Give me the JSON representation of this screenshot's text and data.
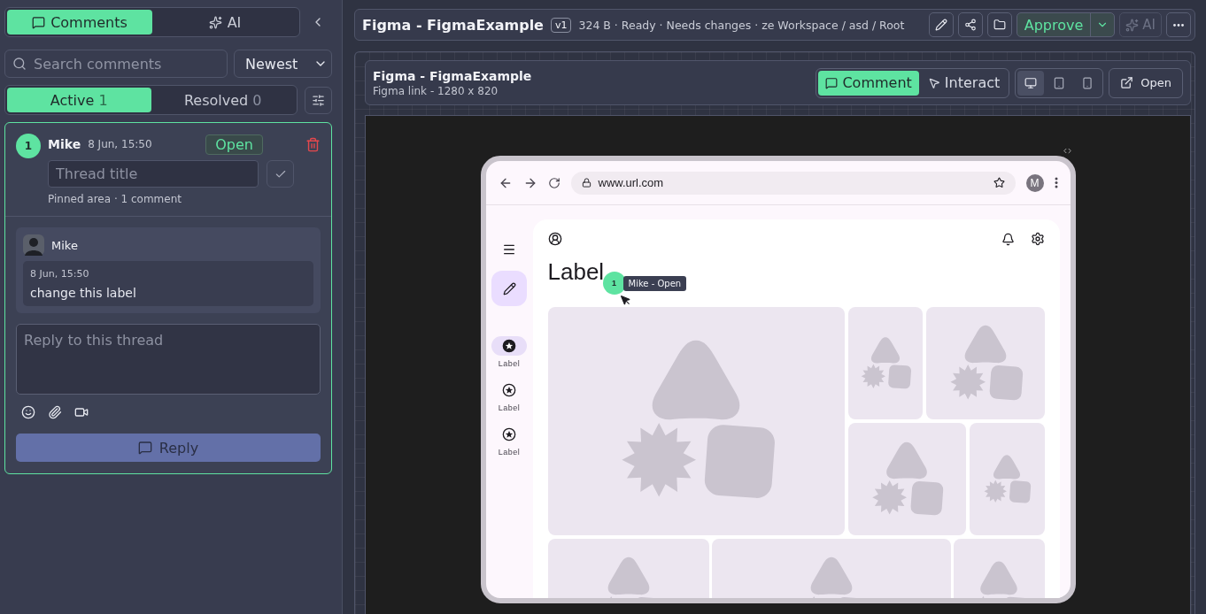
{
  "sidebar": {
    "tabs": [
      {
        "label": "Comments",
        "kind": "comments",
        "selected": true
      },
      {
        "label": "AI",
        "kind": "ai",
        "selected": false
      }
    ],
    "search": {
      "placeholder": "Search comments"
    },
    "sort": {
      "value": "Newest"
    },
    "filters": [
      {
        "label": "Active",
        "count": "1",
        "selected": true
      },
      {
        "label": "Resolved",
        "count": "0",
        "selected": false
      }
    ],
    "threads": [
      {
        "number": "1",
        "author": "Mike",
        "time": "8 Jun, 15:50",
        "status": "Open",
        "title_placeholder": "Thread title",
        "meta": "Pinned area · 1 comment",
        "selected": true,
        "comments": [
          {
            "author": "Mike",
            "time": "8 Jun, 15:50",
            "text": "change this label"
          }
        ],
        "reply_placeholder": "Reply to this thread",
        "reply_button": "Reply"
      }
    ]
  },
  "header": {
    "title": "Figma - FigmaExample",
    "version": "v1",
    "meta": "324 B · Ready · Needs changes · ze Workspace / asd / Root",
    "approve": "Approve",
    "ai": {
      "label": "AI",
      "disabled": true
    }
  },
  "embed": {
    "title": "Figma - FigmaExample",
    "subtitle": "Figma link - 1280 x 820",
    "modes": [
      {
        "label": "Comment",
        "kind": "comment",
        "selected": true
      },
      {
        "label": "Interact",
        "kind": "interact",
        "selected": false
      }
    ],
    "devices": [
      {
        "kind": "desktop",
        "selected": true
      },
      {
        "kind": "tablet",
        "selected": false
      },
      {
        "kind": "phone",
        "selected": false
      }
    ],
    "open": "Open"
  },
  "design": {
    "url": "www.url.com",
    "avatar": "M",
    "heading": "Label",
    "nav": [
      {
        "label": "Label",
        "selected": true
      },
      {
        "label": "Label",
        "selected": false
      },
      {
        "label": "Label",
        "selected": false
      }
    ],
    "pin": {
      "number": "1",
      "tooltip": "Mike - Open"
    }
  }
}
